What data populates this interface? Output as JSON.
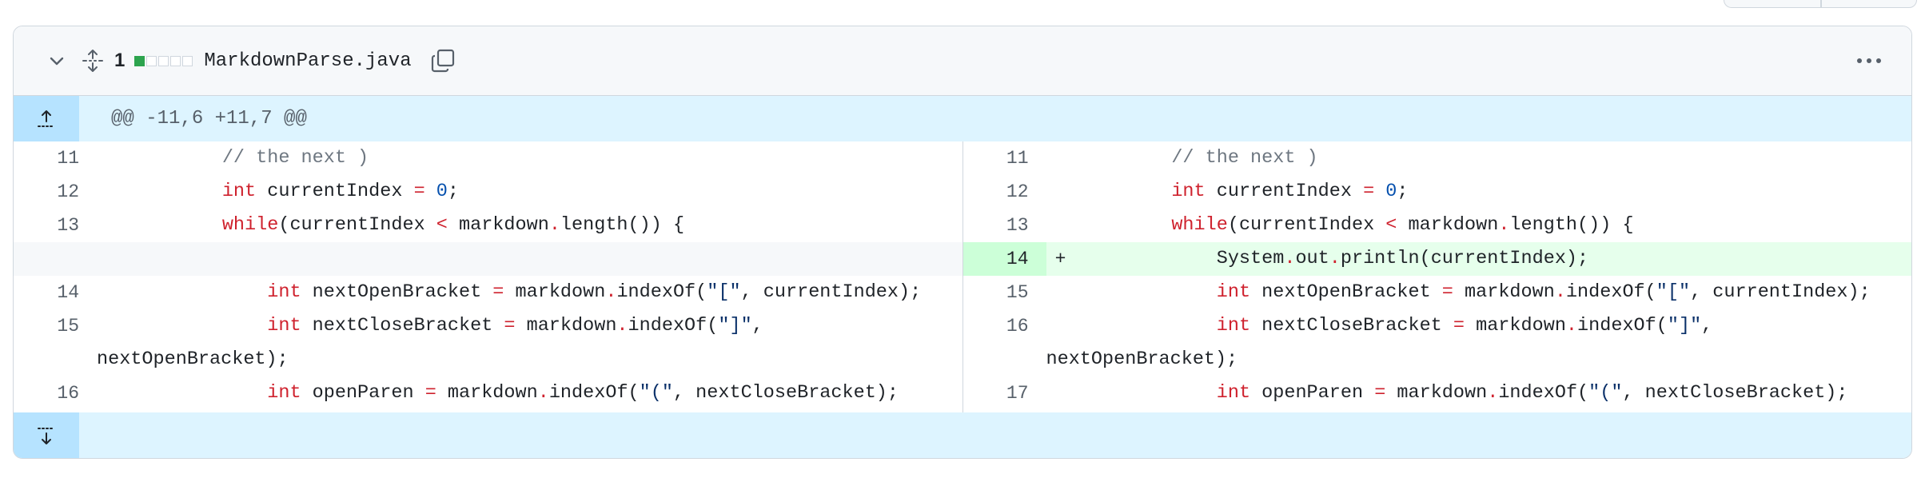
{
  "file": {
    "change_count": "1",
    "file_name": "MarkdownParse.java",
    "diffstat": [
      "added",
      "neutral",
      "neutral",
      "neutral",
      "neutral"
    ]
  },
  "hunk": {
    "header": "@@ -11,6 +11,7 @@"
  },
  "icons": {
    "collapse": "chevron-down-icon",
    "expand_all": "unfold-icon",
    "copy": "copy-icon",
    "more": "kebab-horizontal-icon",
    "expand_up": "expand-up-icon",
    "expand_down": "expand-down-icon"
  },
  "colors": {
    "added_bg": "#e6ffec",
    "added_gutter": "#ccffd8",
    "hunk_bg": "#ddf4ff",
    "hunk_gutter": "#b6e3ff",
    "keyword": "#cf222e",
    "number": "#0550ae",
    "diffstat_added": "#2da44e"
  },
  "left": {
    "lines": [
      {
        "num": "11",
        "code": "        // the next )"
      },
      {
        "num": "12",
        "code": "        int currentIndex = 0;"
      },
      {
        "num": "13",
        "code": "        while(currentIndex < markdown.length()) {"
      },
      {
        "num": "",
        "code": ""
      },
      {
        "num": "14",
        "code": "            int nextOpenBracket = markdown.indexOf(\"[\", currentIndex);"
      },
      {
        "num": "15",
        "code": "            int nextCloseBracket = markdown.indexOf(\"]\",",
        "cont": "nextOpenBracket);"
      },
      {
        "num": "16",
        "code": "            int openParen = markdown.indexOf(\"(\", nextCloseBracket);"
      }
    ]
  },
  "right": {
    "lines": [
      {
        "num": "11",
        "code": "        // the next )"
      },
      {
        "num": "12",
        "code": "        int currentIndex = 0;"
      },
      {
        "num": "13",
        "code": "        while(currentIndex < markdown.length()) {"
      },
      {
        "num": "14",
        "sign": "+",
        "code": "            System.out.println(currentIndex);"
      },
      {
        "num": "15",
        "code": "            int nextOpenBracket = markdown.indexOf(\"[\", currentIndex);"
      },
      {
        "num": "16",
        "code": "            int nextCloseBracket = markdown.indexOf(\"]\",",
        "cont": "nextOpenBracket);"
      },
      {
        "num": "17",
        "code": "            int openParen = markdown.indexOf(\"(\", nextCloseBracket);"
      }
    ]
  }
}
